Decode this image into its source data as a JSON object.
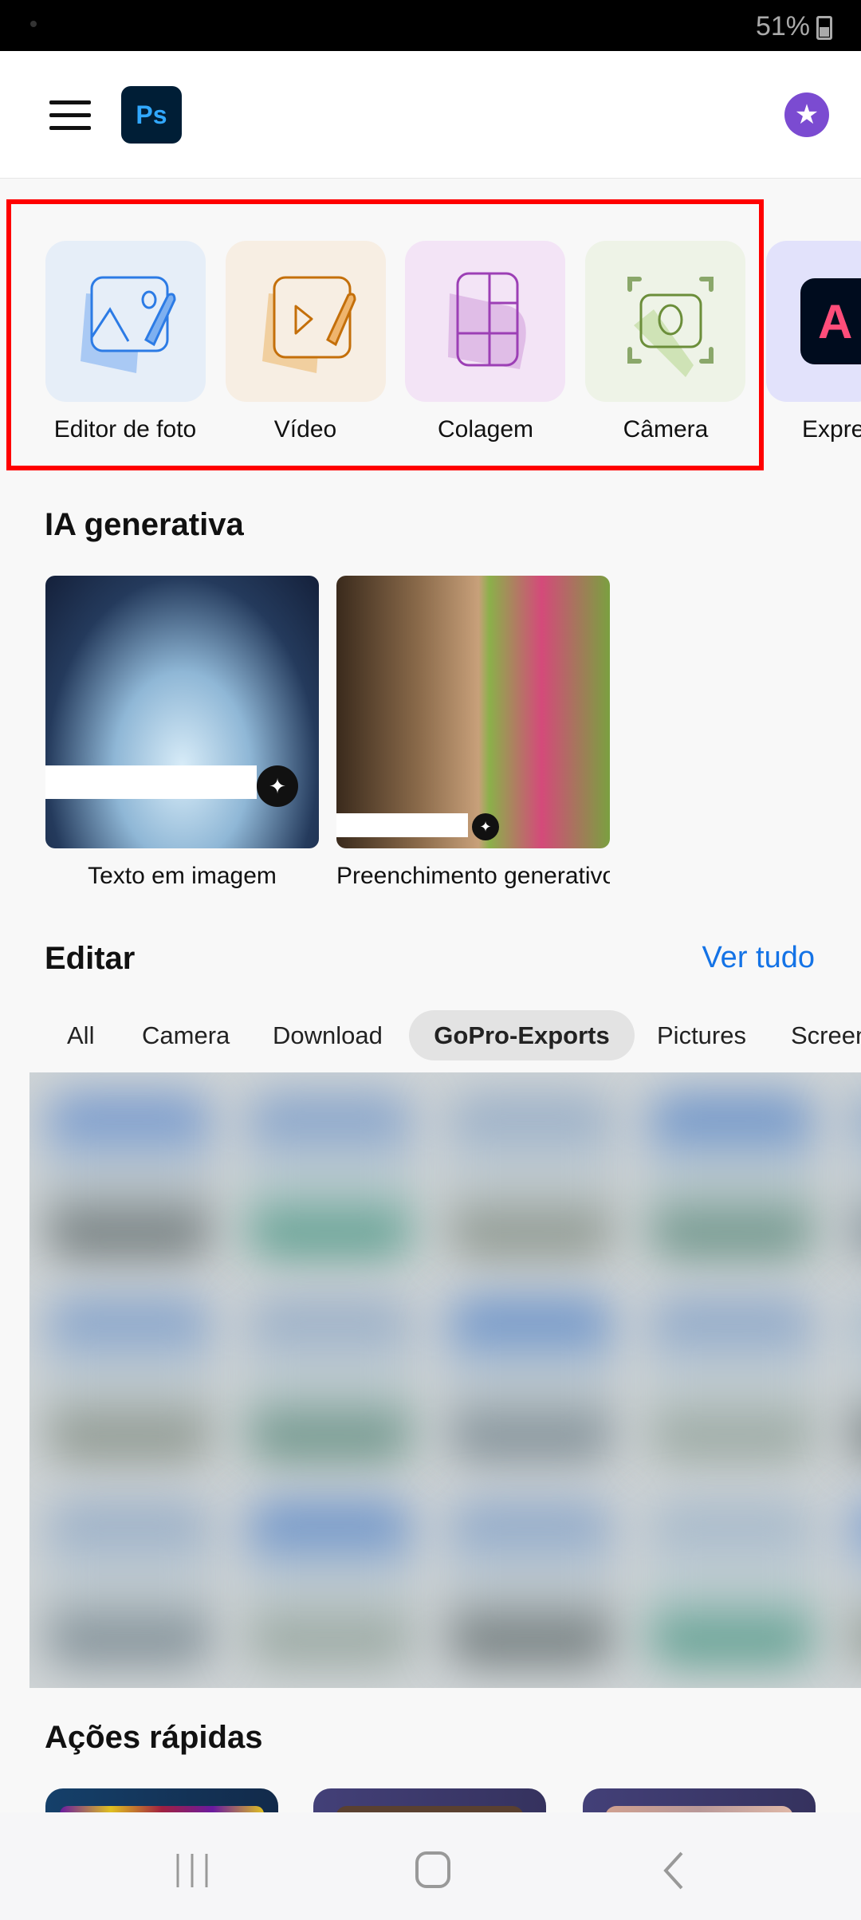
{
  "status_bar": {
    "battery": "51%"
  },
  "header": {
    "logo": "Ps",
    "menu_icon": "hamburger-icon",
    "premium_icon": "star-icon"
  },
  "tools": [
    {
      "label": "Editor de foto",
      "icon": "photo-edit-icon",
      "bg": "#e6eef8"
    },
    {
      "label": "Vídeo",
      "icon": "video-edit-icon",
      "bg": "#f7eee3"
    },
    {
      "label": "Colagem",
      "icon": "collage-icon",
      "bg": "#f3e4f6"
    },
    {
      "label": "Câmera",
      "icon": "camera-icon",
      "bg": "#eef3e7"
    },
    {
      "label": "Expre",
      "icon": "adobe-express-icon",
      "bg": "#e2e2fb"
    }
  ],
  "generative": {
    "title": "IA generativa",
    "cards": [
      {
        "label": "Texto em imagem"
      },
      {
        "label": "Preenchimento generativo"
      }
    ]
  },
  "edit": {
    "title": "Editar",
    "see_all": "Ver tudo",
    "folders": [
      "All",
      "Camera",
      "Download",
      "GoPro-Exports",
      "Pictures",
      "Screen"
    ],
    "selected_folder": "GoPro-Exports"
  },
  "quick_actions": {
    "title": "Ações rápidas"
  },
  "colors": {
    "accent": "#1473e6",
    "highlight": "#ff0000"
  }
}
